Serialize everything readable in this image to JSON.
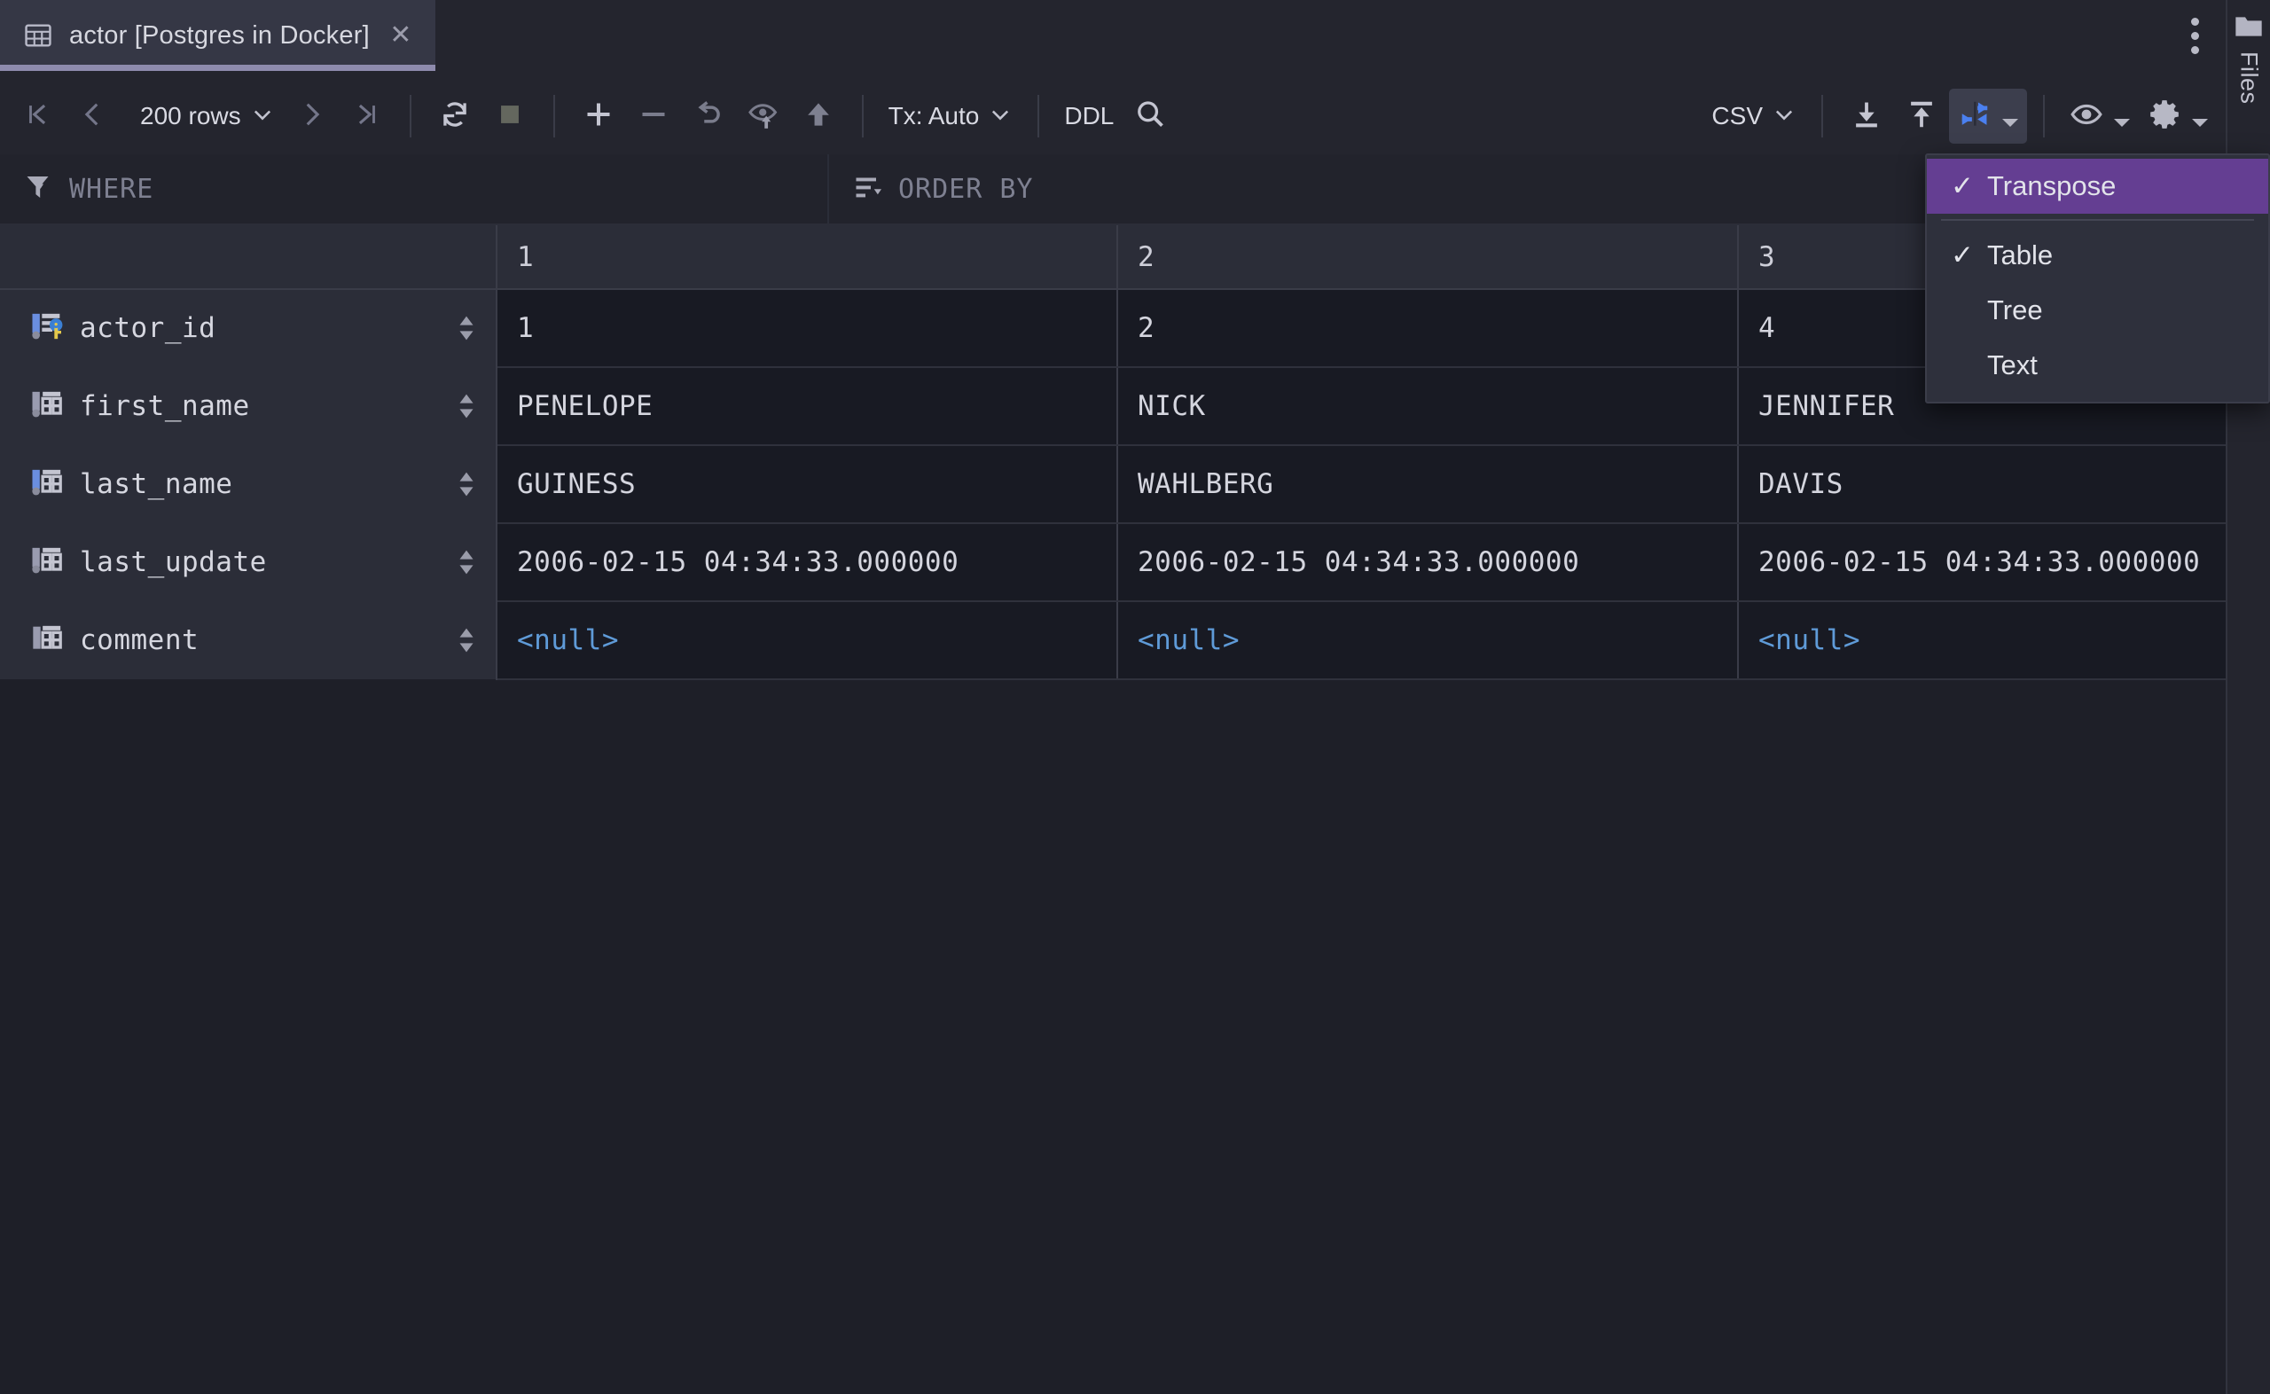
{
  "window": {
    "tab": {
      "icon": "table-icon",
      "title": "actor [Postgres in Docker]",
      "close": "✕"
    },
    "tabbar_overflow_icon": "more-vertical-icon"
  },
  "toolbar": {
    "first_page_icon": "skip-to-first-icon",
    "prev_page_icon": "chevron-left-icon",
    "rows_label": "200 rows",
    "next_page_icon": "chevron-right-icon",
    "last_page_icon": "skip-to-last-icon",
    "refresh_icon": "refresh-icon",
    "stop_icon": "stop-icon",
    "add_row_icon": "plus-icon",
    "delete_row_icon": "minus-icon",
    "revert_icon": "undo-icon",
    "preview_icon": "preview-changes-icon",
    "submit_icon": "submit-up-arrow-icon",
    "tx_label": "Tx: Auto",
    "ddl_label": "DDL",
    "search_icon": "search-icon",
    "format_label": "CSV",
    "export_icon": "export-download-icon",
    "import_icon": "import-upload-icon",
    "transpose_icon": "transpose-icon",
    "view_icon": "eye-icon",
    "settings_icon": "gear-icon"
  },
  "filters": {
    "filter_icon": "funnel-icon",
    "where_placeholder": "WHERE",
    "sort_icon": "sort-icon",
    "orderby_placeholder": "ORDER BY"
  },
  "view_menu": {
    "items": [
      {
        "label": "Transpose",
        "checked": true,
        "selected": true
      },
      {
        "label": "Table",
        "checked": true,
        "selected": false
      },
      {
        "label": "Tree",
        "checked": false,
        "selected": false
      },
      {
        "label": "Text",
        "checked": false,
        "selected": false
      }
    ],
    "check_glyph": "✓",
    "highlight_color": "#643e92"
  },
  "grid": {
    "column_headers": [
      "",
      "1",
      "2",
      "3"
    ],
    "rows": [
      {
        "name": "actor_id",
        "icon": "column-primary-key-icon",
        "values": [
          "1",
          "2",
          "4"
        ],
        "null_flags": [
          false,
          false,
          false
        ]
      },
      {
        "name": "first_name",
        "icon": "column-icon",
        "values": [
          "PENELOPE",
          "NICK",
          "JENNIFER"
        ],
        "null_flags": [
          false,
          false,
          false
        ]
      },
      {
        "name": "last_name",
        "icon": "column-indexed-icon",
        "values": [
          "GUINESS",
          "WAHLBERG",
          "DAVIS"
        ],
        "null_flags": [
          false,
          false,
          false
        ]
      },
      {
        "name": "last_update",
        "icon": "column-icon",
        "values": [
          "2006-02-15 04:34:33.000000",
          "2006-02-15 04:34:33.000000",
          "2006-02-15 04:34:33.000000"
        ],
        "null_flags": [
          false,
          false,
          false
        ]
      },
      {
        "name": "comment",
        "icon": "column-plain-icon",
        "values": [
          "<null>",
          "<null>",
          "<null>"
        ],
        "null_flags": [
          true,
          true,
          true
        ]
      }
    ],
    "null_color": "#5f9bd8"
  },
  "sidebar": {
    "folder_icon": "folder-icon",
    "label": "Files"
  }
}
